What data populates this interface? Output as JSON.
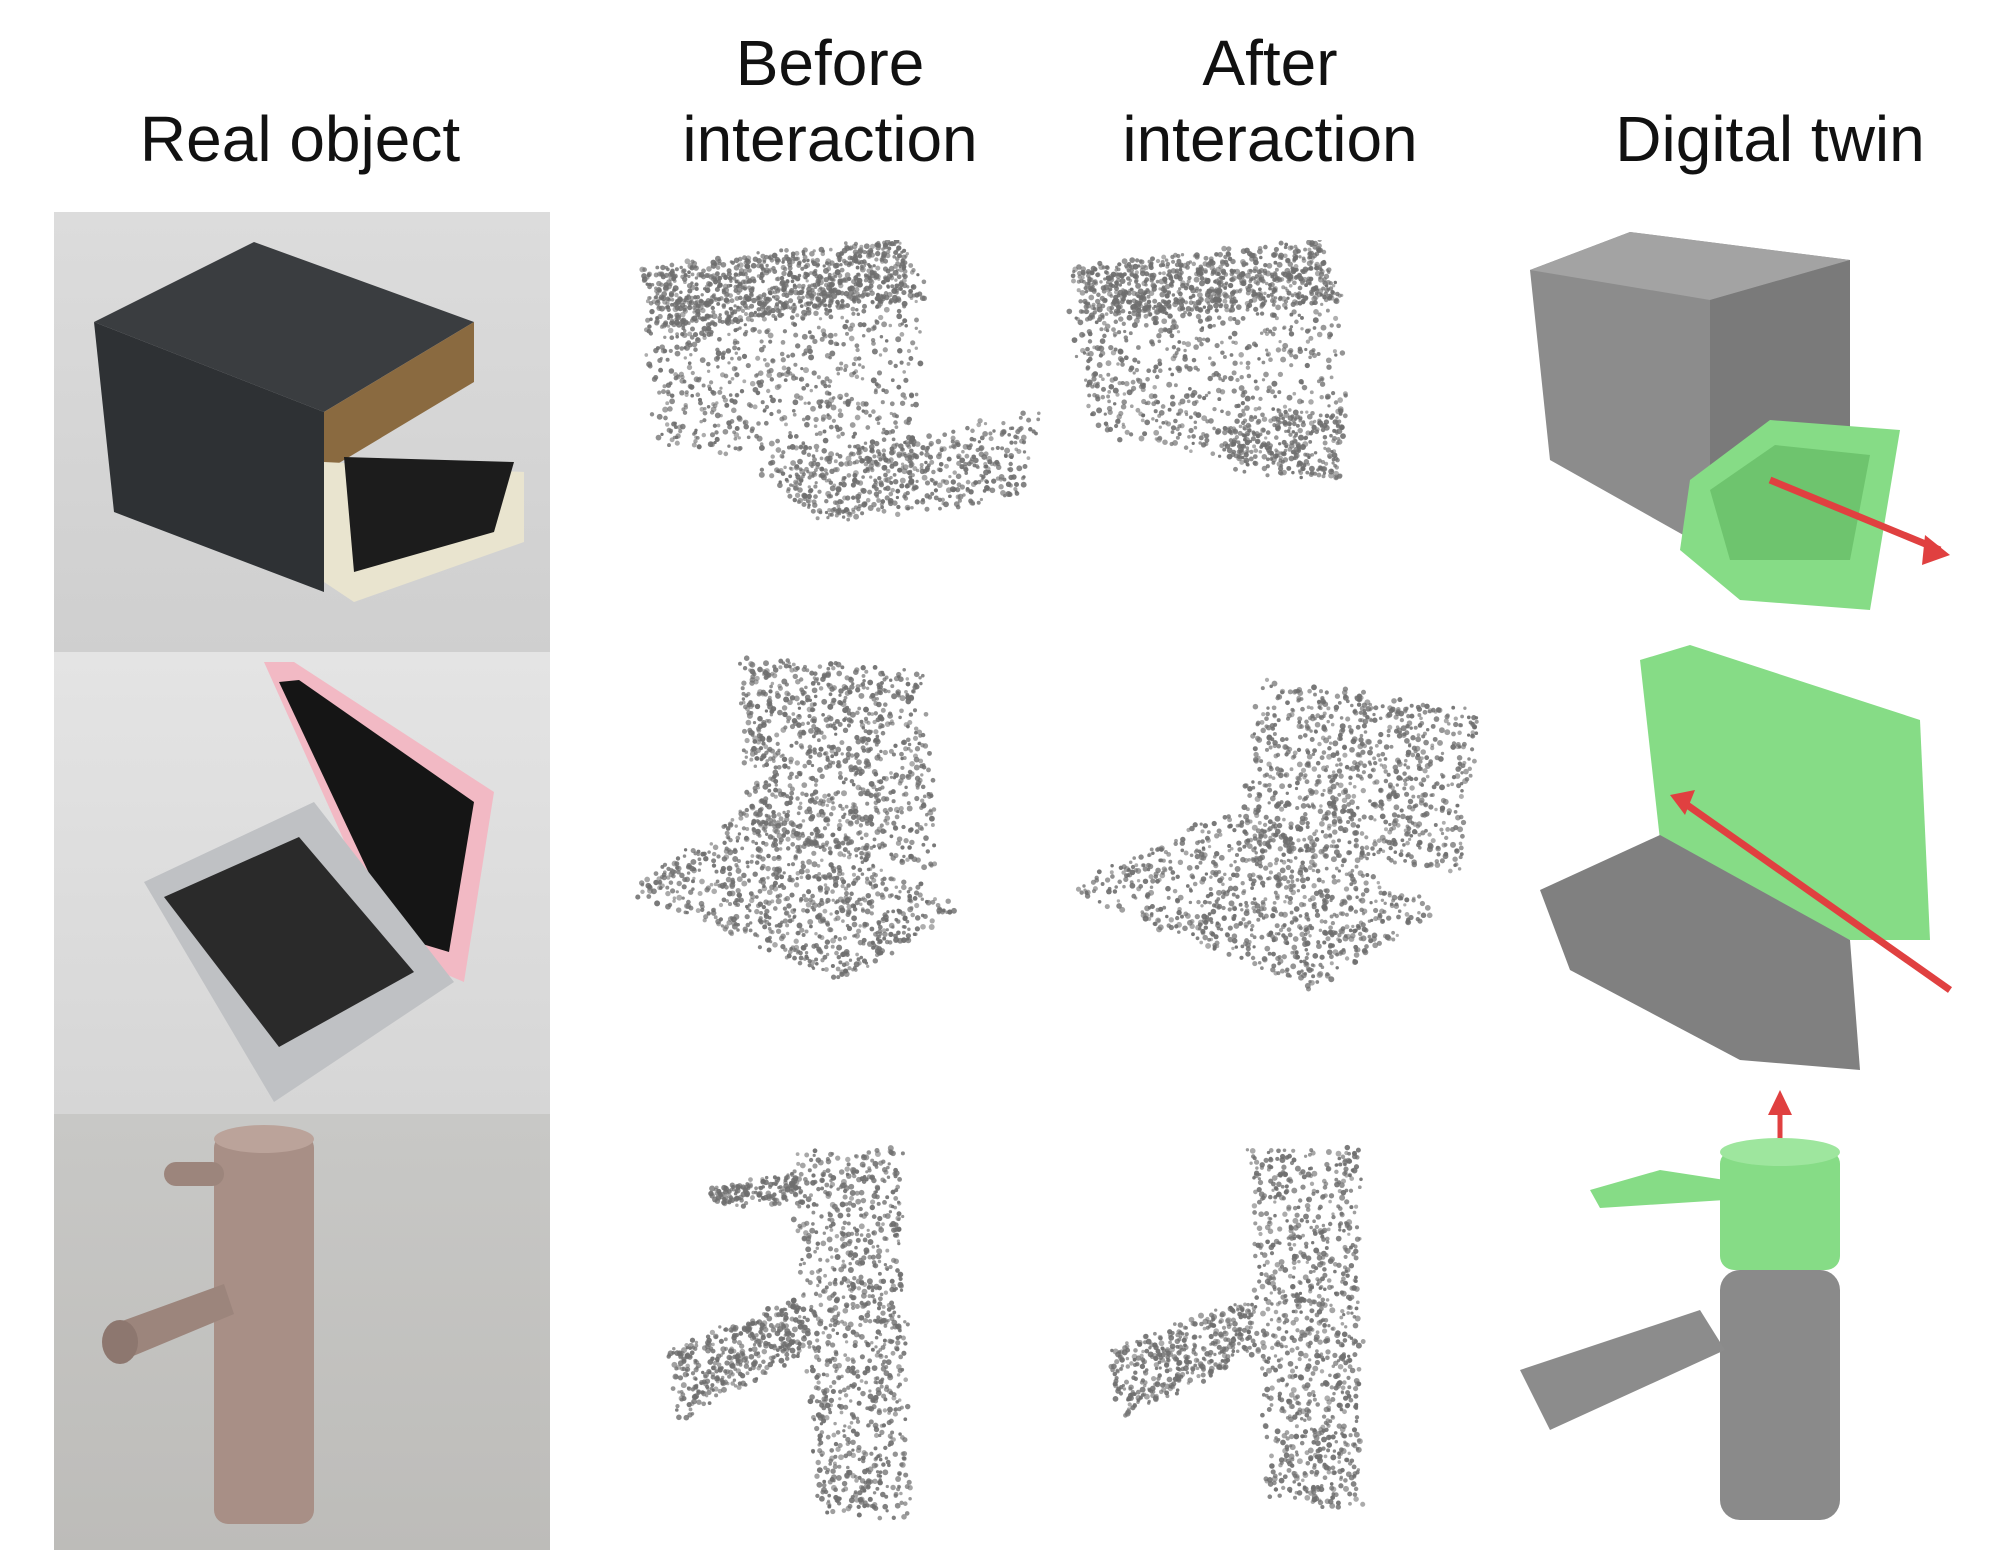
{
  "headers": {
    "real_object": "Real object",
    "before_interaction": "Before\ninteraction",
    "after_interaction": "After\ninteraction",
    "digital_twin": "Digital twin"
  },
  "rows": [
    {
      "object": "box with drawer",
      "icon": "drawer"
    },
    {
      "object": "laptop",
      "icon": "laptop"
    },
    {
      "object": "faucet",
      "icon": "faucet"
    }
  ],
  "colors": {
    "point_cloud": "#6e6e6e",
    "mesh_static": "#8a8a8a",
    "mesh_moving_part": "#86dc86",
    "joint_axis": "#e04040"
  }
}
